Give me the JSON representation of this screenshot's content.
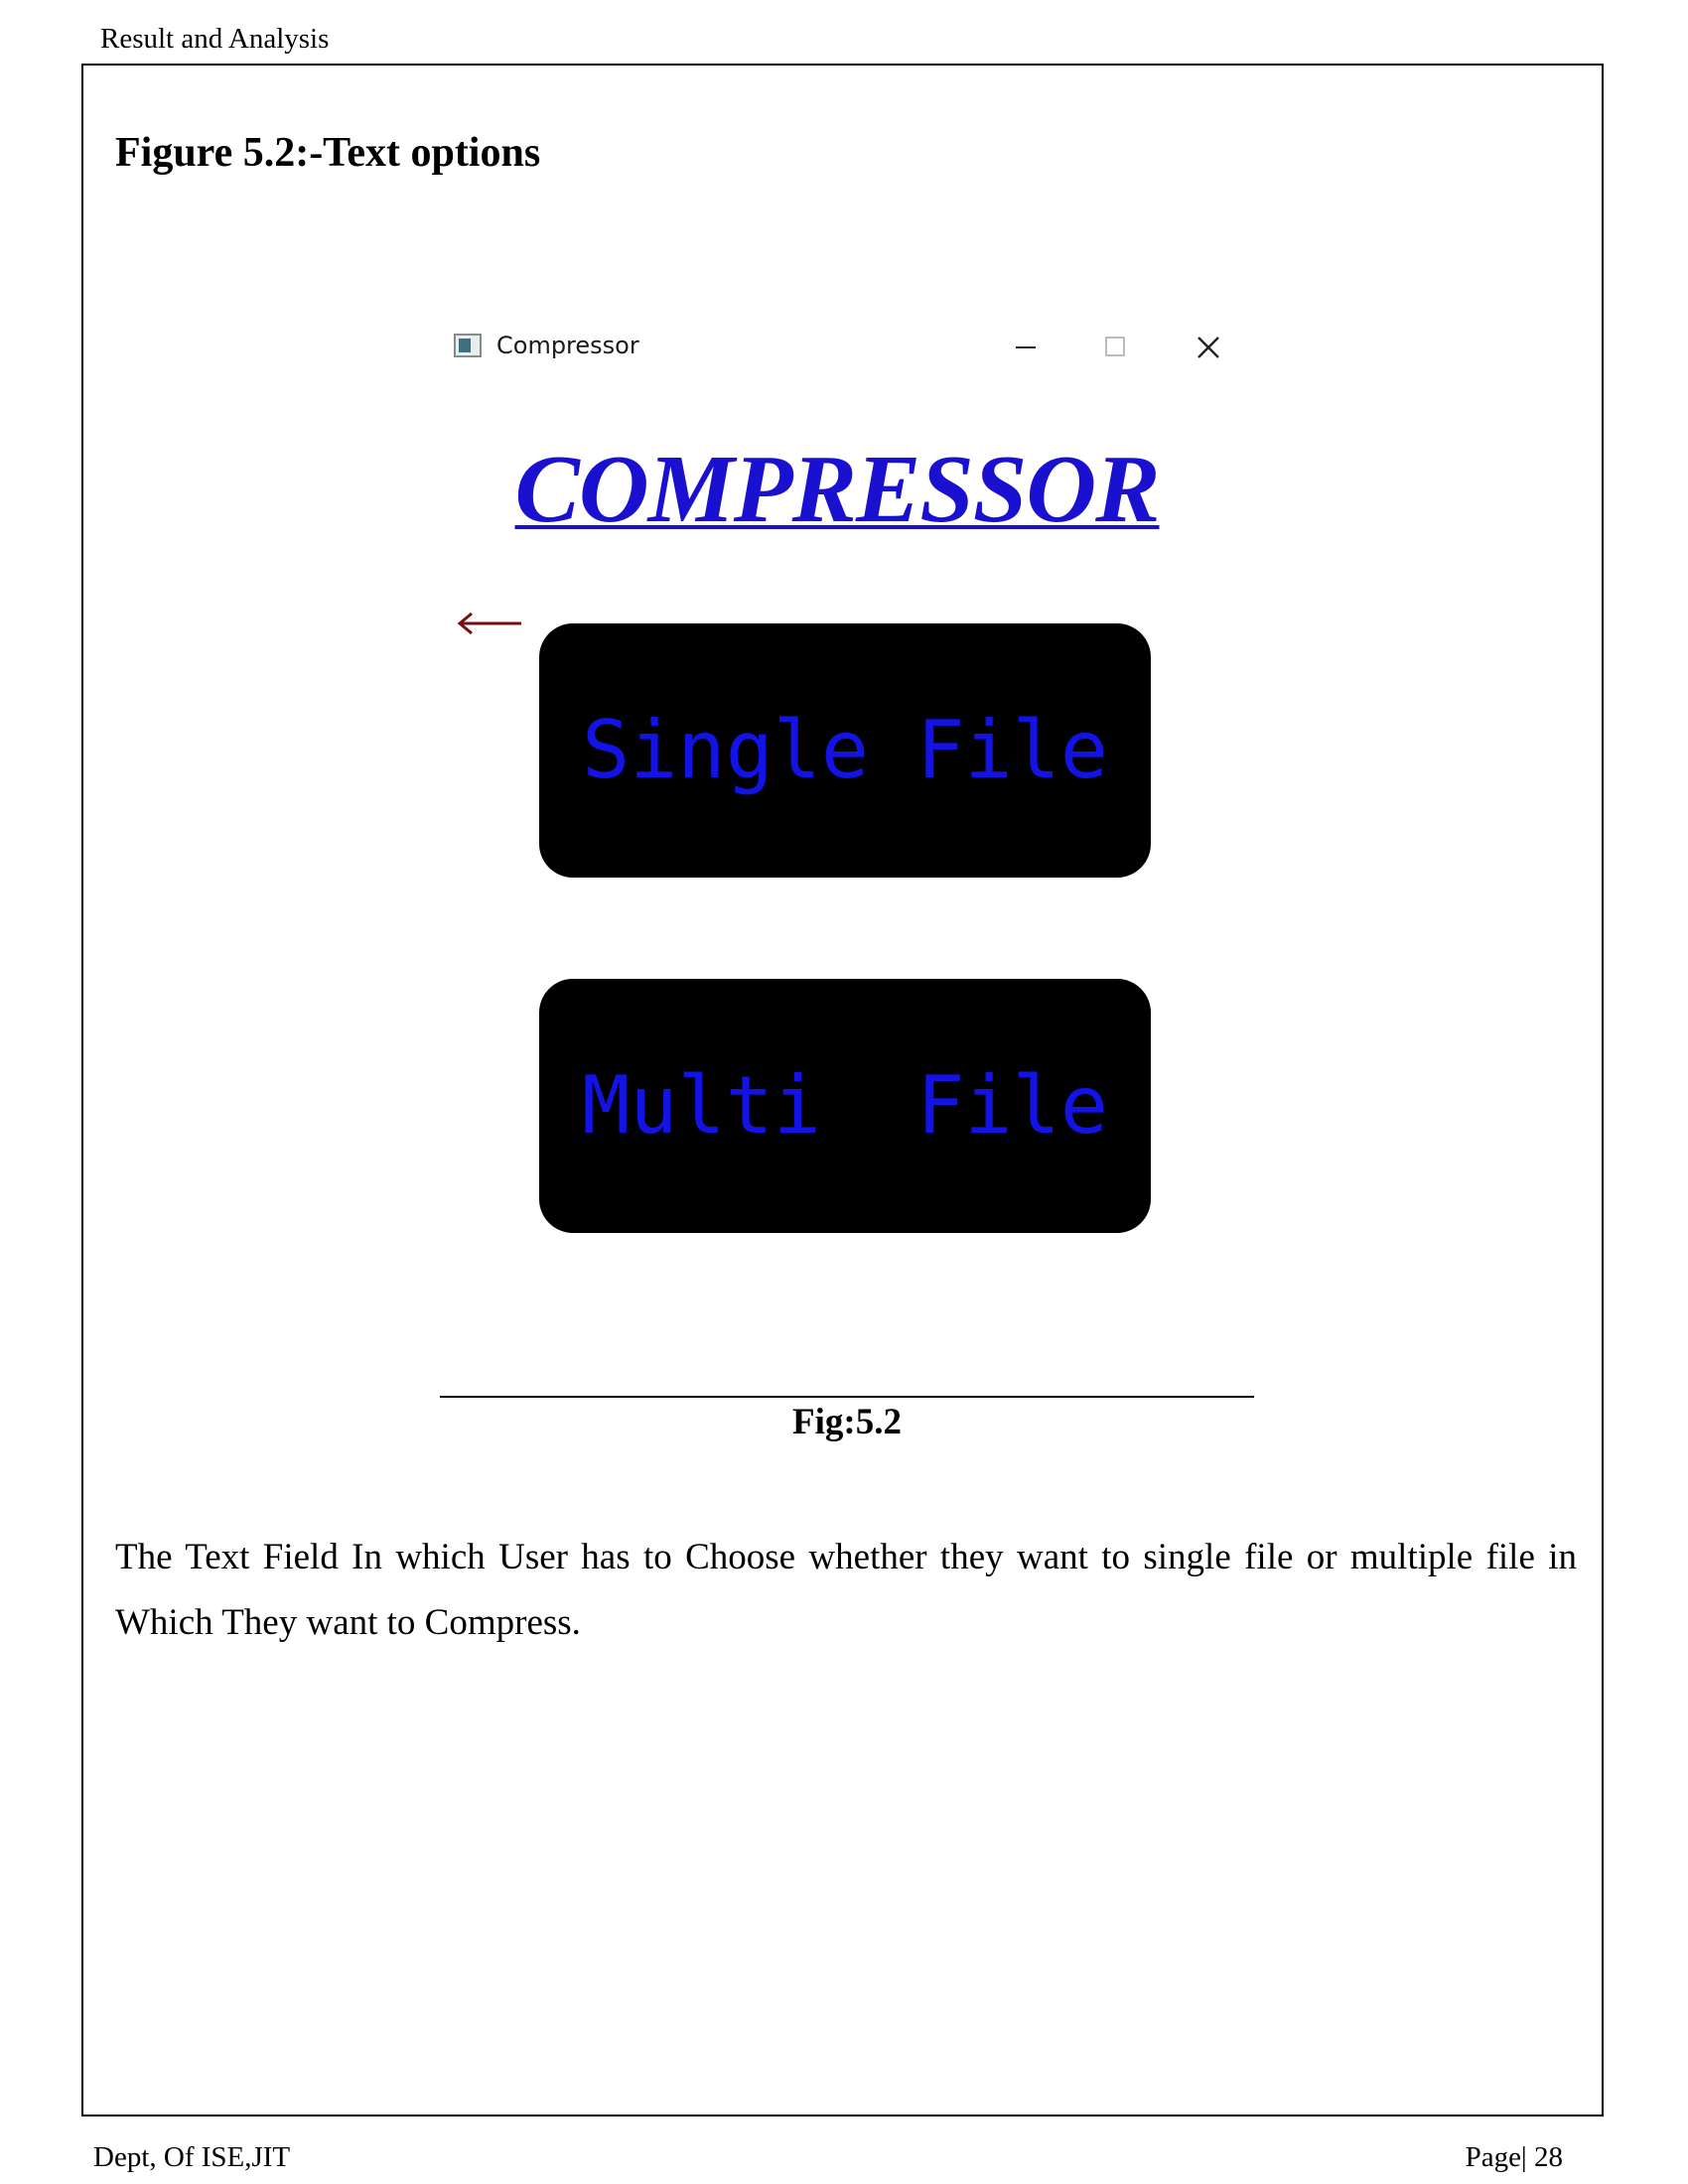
{
  "header": {
    "running_title": "Result and Analysis"
  },
  "figure": {
    "heading": "Figure 5.2:-Text options",
    "caption": "Fig:5.2"
  },
  "app_window": {
    "title": "Compressor",
    "heading": "COMPRESSOR",
    "heading_color": "#1a11d0",
    "buttons": {
      "single_file": "Single File",
      "multi_file": "Multi  File"
    },
    "button_background": "#000000",
    "button_text_color": "#1313e6",
    "back_arrow_color": "#7a0f0f",
    "icons": {
      "app": "window-app-icon",
      "minimize": "minimize-icon",
      "maximize": "maximize-icon",
      "close": "close-icon",
      "back": "back-arrow-icon"
    }
  },
  "body": {
    "paragraph": "The Text Field In which User has to Choose whether they want to single file or multiple file in Which They want to Compress."
  },
  "footer": {
    "left": "Dept, Of ISE,JIT",
    "right": "Page| 28"
  }
}
